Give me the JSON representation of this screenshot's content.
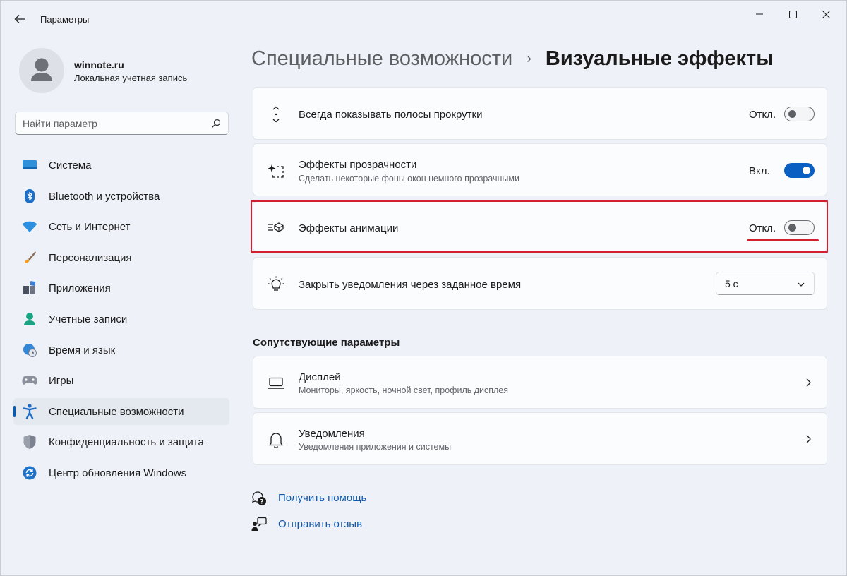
{
  "window": {
    "app_title": "Параметры"
  },
  "user": {
    "name": "winnote.ru",
    "account_type": "Локальная учетная запись"
  },
  "search": {
    "placeholder": "Найти параметр"
  },
  "nav": {
    "items": [
      {
        "label": "Система",
        "icon": "system-icon"
      },
      {
        "label": "Bluetooth и устройства",
        "icon": "bluetooth-icon"
      },
      {
        "label": "Сеть и Интернет",
        "icon": "wifi-icon"
      },
      {
        "label": "Персонализация",
        "icon": "brush-icon"
      },
      {
        "label": "Приложения",
        "icon": "apps-icon"
      },
      {
        "label": "Учетные записи",
        "icon": "account-icon"
      },
      {
        "label": "Время и язык",
        "icon": "globe-clock-icon"
      },
      {
        "label": "Игры",
        "icon": "gamepad-icon"
      },
      {
        "label": "Специальные возможности",
        "icon": "accessibility-icon",
        "active": true
      },
      {
        "label": "Конфиденциальность и защита",
        "icon": "shield-icon"
      },
      {
        "label": "Центр обновления Windows",
        "icon": "update-icon"
      }
    ]
  },
  "breadcrumb": {
    "parent": "Специальные возможности",
    "separator": "›",
    "current": "Визуальные эффекты"
  },
  "settings": [
    {
      "title": "Всегда показывать полосы прокрутки",
      "subtitle": "",
      "state_label": "Откл.",
      "on": false
    },
    {
      "title": "Эффекты прозрачности",
      "subtitle": "Сделать некоторые фоны окон немного прозрачными",
      "state_label": "Вкл.",
      "on": true
    },
    {
      "title": "Эффекты анимации",
      "subtitle": "",
      "state_label": "Откл.",
      "on": false
    },
    {
      "title": "Закрыть уведомления через заданное время",
      "subtitle": "",
      "dropdown_value": "5 с"
    }
  ],
  "related": {
    "title": "Сопутствующие параметры",
    "items": [
      {
        "title": "Дисплей",
        "subtitle": "Мониторы, яркость, ночной свет, профиль дисплея"
      },
      {
        "title": "Уведомления",
        "subtitle": "Уведомления приложения и системы"
      }
    ]
  },
  "links": {
    "help": "Получить помощь",
    "feedback": "Отправить отзыв"
  },
  "colors": {
    "accent": "#005fb8",
    "toggle_on": "#0a5fc2",
    "highlight": "#d2202e",
    "link": "#0f57a8"
  }
}
